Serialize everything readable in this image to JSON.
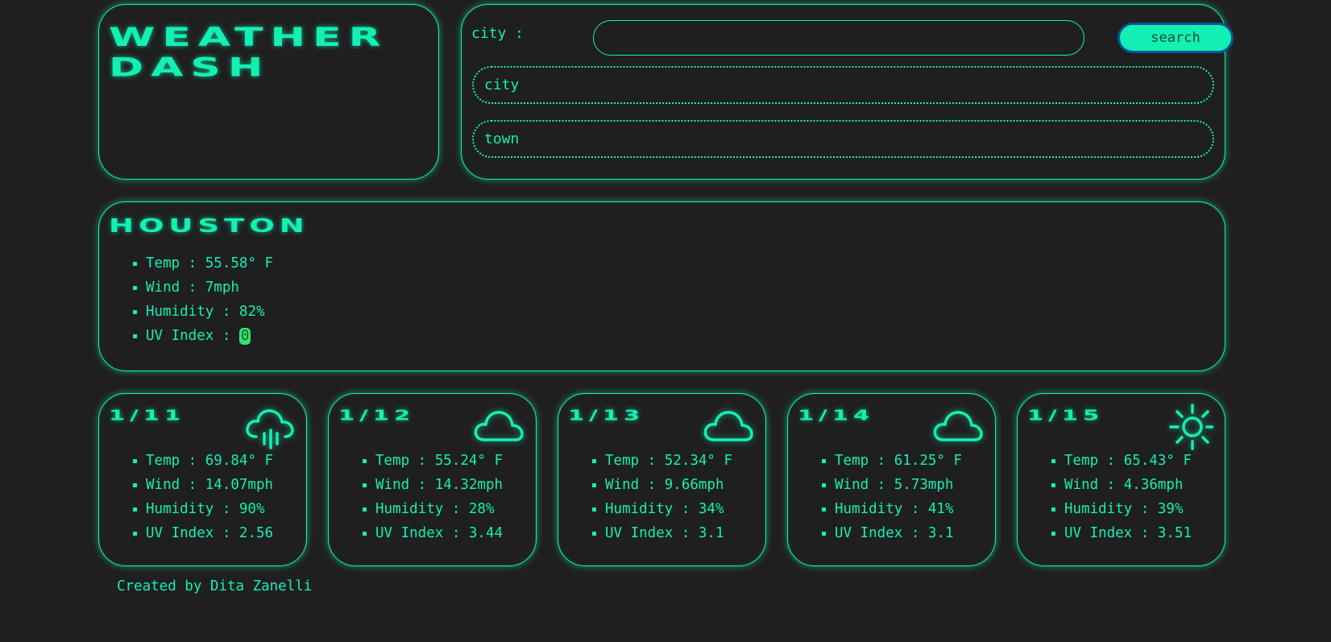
{
  "header": {
    "title_line1": "WEATHER",
    "title_line2": "DASH"
  },
  "search": {
    "label": "city :",
    "value": "",
    "placeholder": "",
    "button_label": "search",
    "history": [
      "city",
      "town"
    ]
  },
  "current": {
    "city": "HOUSTON",
    "temp_label": "Temp : ",
    "temp": "55.58° F",
    "wind_label": "Wind : ",
    "wind": "7mph",
    "humidity_label": "Humidity : ",
    "humidity": "82%",
    "uv_label": "UV Index : ",
    "uv": "0"
  },
  "forecast": [
    {
      "date": "1/11",
      "icon": "cloud-rain-icon",
      "temp": "Temp : 69.84° F",
      "wind": "Wind : 14.07mph",
      "humidity": "Humidity : 90%",
      "uv": "UV Index : 2.56"
    },
    {
      "date": "1/12",
      "icon": "cloud-icon",
      "temp": "Temp : 55.24° F",
      "wind": "Wind : 14.32mph",
      "humidity": "Humidity : 28%",
      "uv": "UV Index : 3.44"
    },
    {
      "date": "1/13",
      "icon": "cloud-icon",
      "temp": "Temp : 52.34° F",
      "wind": "Wind : 9.66mph",
      "humidity": "Humidity : 34%",
      "uv": "UV Index : 3.1"
    },
    {
      "date": "1/14",
      "icon": "cloud-icon",
      "temp": "Temp : 61.25° F",
      "wind": "Wind : 5.73mph",
      "humidity": "Humidity : 41%",
      "uv": "UV Index : 3.1"
    },
    {
      "date": "1/15",
      "icon": "sun-icon",
      "temp": "Temp : 65.43° F",
      "wind": "Wind : 4.36mph",
      "humidity": "Humidity : 39%",
      "uv": "UV Index : 3.51"
    }
  ],
  "footer": {
    "credit": "Created by Dita Zanelli"
  },
  "colors": {
    "background": "#1f1f1f",
    "accent": "#13f0b4",
    "uv_low": "#34e36e",
    "button_border": "#06569b"
  }
}
